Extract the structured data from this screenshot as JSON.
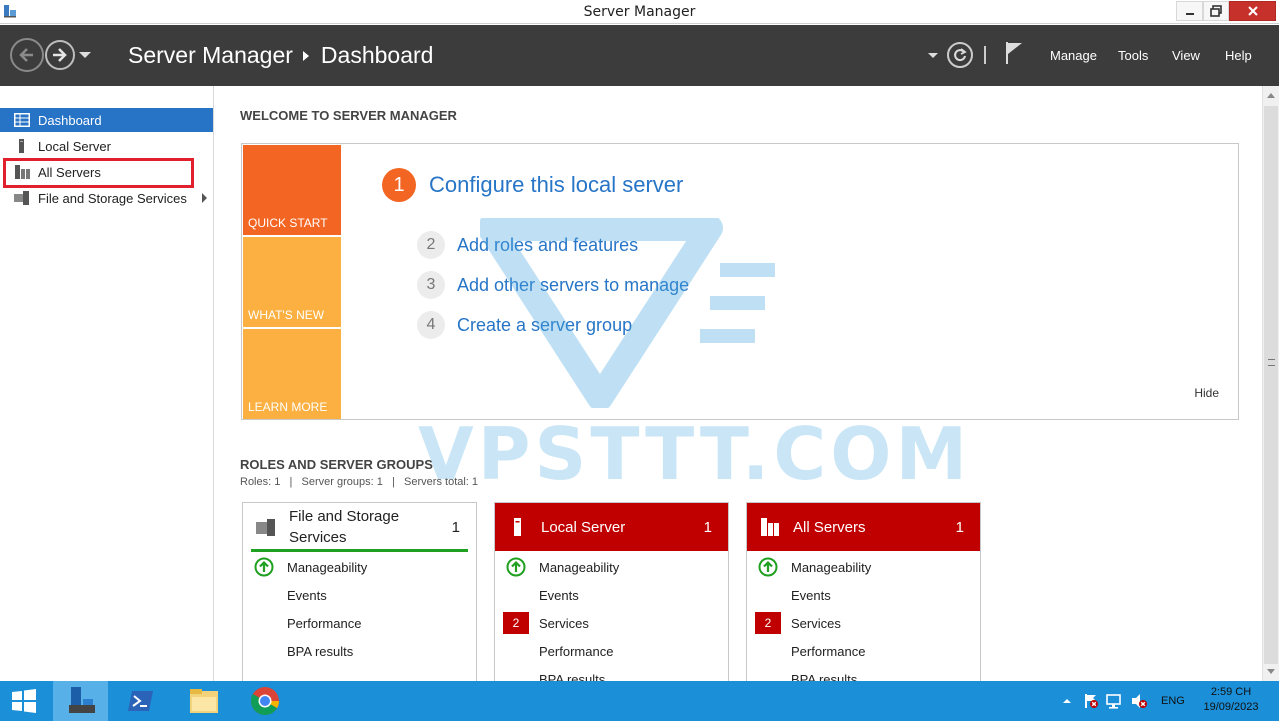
{
  "window": {
    "title": "Server Manager"
  },
  "header": {
    "breadcrumb_root": "Server Manager",
    "breadcrumb_page": "Dashboard",
    "menus": [
      "Manage",
      "Tools",
      "View",
      "Help"
    ]
  },
  "sidebar": {
    "items": [
      {
        "label": "Dashboard",
        "active": true
      },
      {
        "label": "Local Server",
        "active": false
      },
      {
        "label": "All Servers",
        "active": false
      },
      {
        "label": "File and Storage Services",
        "active": false
      }
    ]
  },
  "welcome": {
    "title": "WELCOME TO SERVER MANAGER",
    "tiles": [
      "QUICK START",
      "WHAT'S NEW",
      "LEARN MORE"
    ],
    "step1": {
      "num": "1",
      "label": "Configure this local server"
    },
    "steps": [
      {
        "num": "2",
        "label": "Add roles and features"
      },
      {
        "num": "3",
        "label": "Add other servers to manage"
      },
      {
        "num": "4",
        "label": "Create a server group"
      }
    ],
    "hide": "Hide"
  },
  "roles": {
    "title": "ROLES AND SERVER GROUPS",
    "stats": "Roles: 1   |   Server groups: 1   |   Servers total: 1",
    "cards": [
      {
        "name": "File and Storage Services",
        "count": "1",
        "rows": [
          {
            "label": "Manageability",
            "status": "ok"
          },
          {
            "label": "Events",
            "status": ""
          },
          {
            "label": "Performance",
            "status": ""
          },
          {
            "label": "BPA results",
            "status": ""
          }
        ]
      },
      {
        "name": "Local Server",
        "count": "1",
        "rows": [
          {
            "label": "Manageability",
            "status": "ok"
          },
          {
            "label": "Events",
            "status": ""
          },
          {
            "label": "Services",
            "status": "2"
          },
          {
            "label": "Performance",
            "status": ""
          },
          {
            "label": "BPA results",
            "status": ""
          }
        ]
      },
      {
        "name": "All Servers",
        "count": "1",
        "rows": [
          {
            "label": "Manageability",
            "status": "ok"
          },
          {
            "label": "Events",
            "status": ""
          },
          {
            "label": "Services",
            "status": "2"
          },
          {
            "label": "Performance",
            "status": ""
          },
          {
            "label": "BPA results",
            "status": ""
          }
        ]
      }
    ]
  },
  "watermark": {
    "text": "VPSTTT.COM"
  },
  "taskbar": {
    "lang": "ENG",
    "time": "2:59 CH",
    "date": "19/09/2023"
  },
  "colors": {
    "accent": "#2773c6",
    "header_bg": "#3c3c3c",
    "quick_start": "#f26522",
    "tile_yellow": "#fbb041",
    "alert_red": "#c00000",
    "ok_green": "#20a020",
    "taskbar": "#1b8fd8"
  }
}
